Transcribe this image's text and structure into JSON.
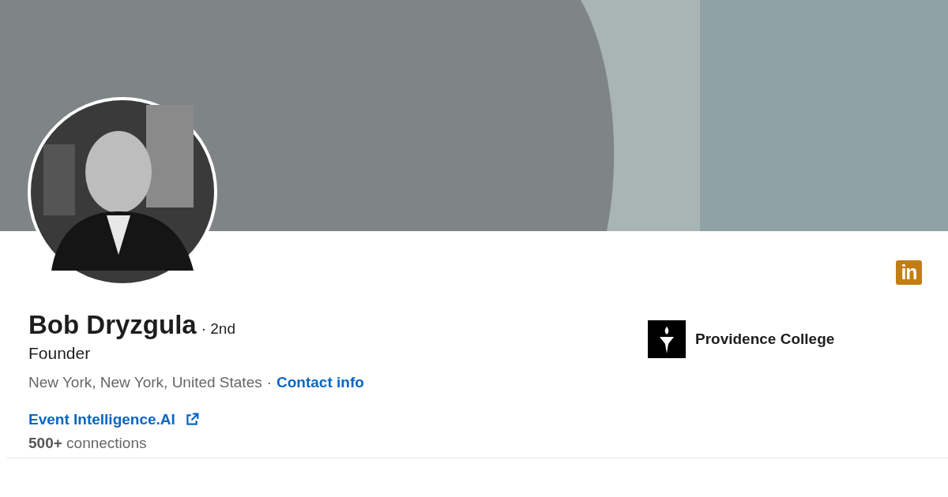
{
  "profile": {
    "name": "Bob Dryzgula",
    "degree": "· 2nd",
    "headline": "Founder",
    "location": "New York, New York, United States",
    "separator": "·",
    "contact_link": "Contact info",
    "website": "Event Intelligence.AI",
    "connections": "**500+** connections"
  },
  "brand_badge": {
    "text": "in"
  },
  "education": {
    "school": "Providence College"
  }
}
